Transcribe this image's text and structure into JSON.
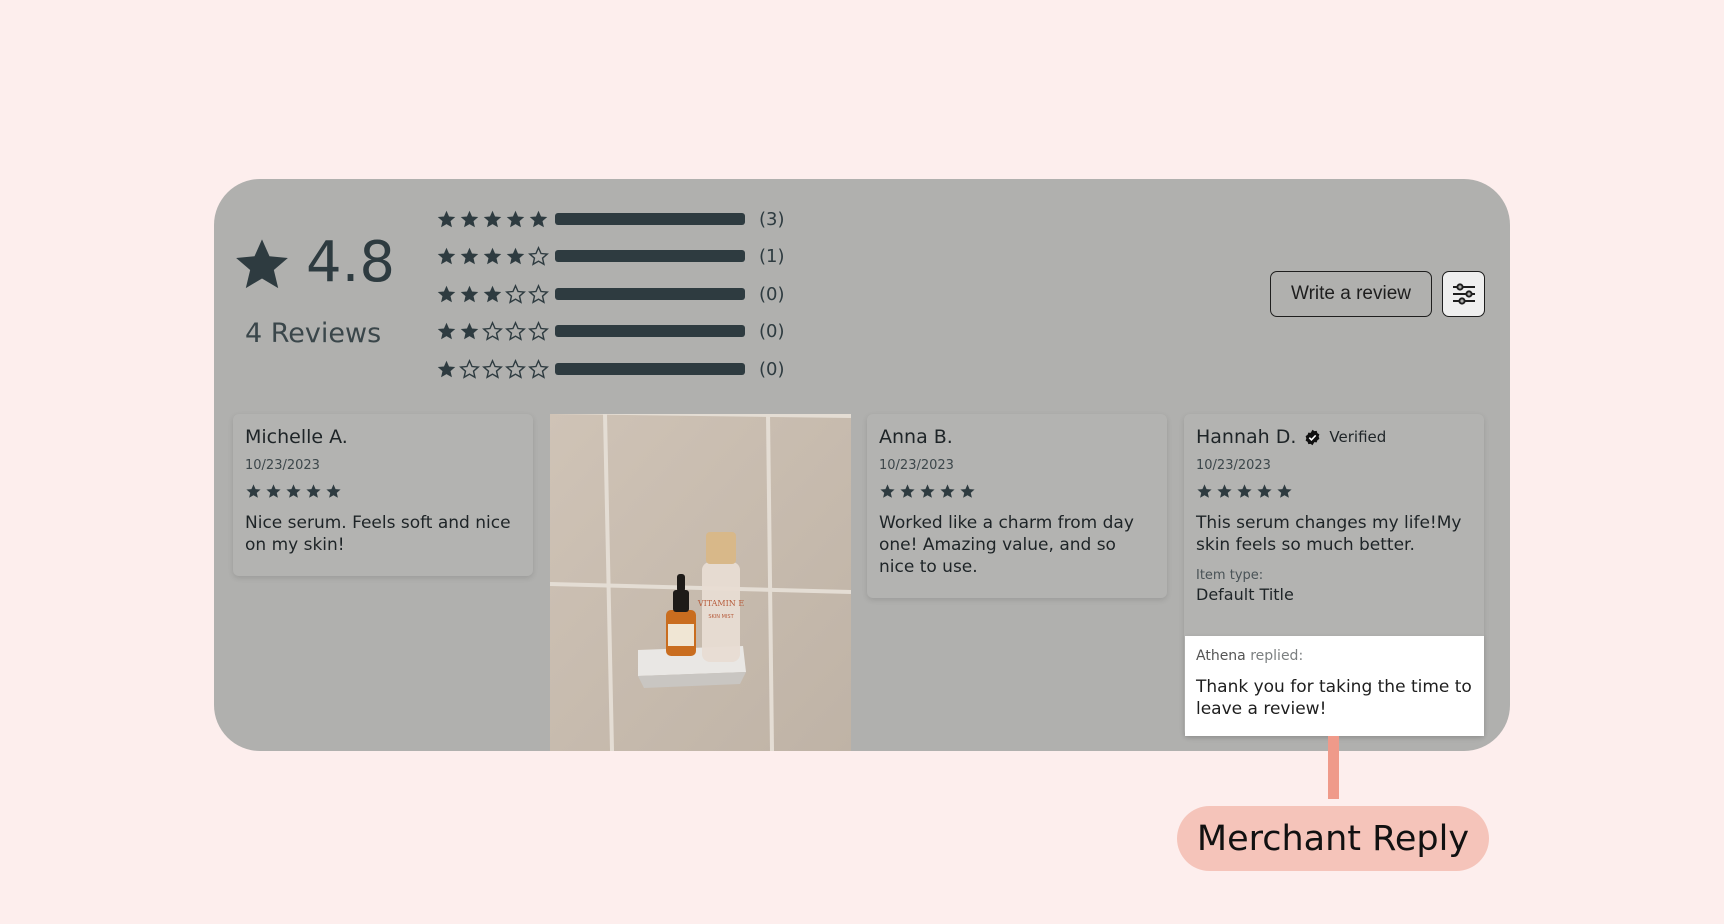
{
  "summary": {
    "average": "4.8",
    "reviews_label": "4 Reviews",
    "distribution": [
      {
        "stars": 5,
        "count_label": "(3)",
        "fraction": 1.0
      },
      {
        "stars": 4,
        "count_label": "(1)",
        "fraction": 1.0
      },
      {
        "stars": 3,
        "count_label": "(0)",
        "fraction": 1.0
      },
      {
        "stars": 2,
        "count_label": "(0)",
        "fraction": 1.0
      },
      {
        "stars": 1,
        "count_label": "(0)",
        "fraction": 1.0
      }
    ]
  },
  "actions": {
    "write_review_label": "Write a review",
    "filter_icon": "sliders-icon"
  },
  "reviews": [
    {
      "name": "Michelle A.",
      "date": "10/23/2023",
      "rating": 5,
      "body": "Nice serum. Feels soft and nice on my skin!"
    },
    {
      "name": "Anna B.",
      "date": "10/23/2023",
      "rating": 5,
      "body": "Worked like a charm from day one! Amazing value, and so nice to use."
    },
    {
      "name": "Hannah D.",
      "verified_label": "Verified",
      "date": "10/23/2023",
      "rating": 5,
      "body": "This serum changes my life!My skin feels so much better.",
      "item_type_label": "Item type:",
      "item_type_value": "Default Title",
      "reply": {
        "author": "Athena",
        "replied_label": " replied:",
        "text": "Thank you for taking the time to leave a review!"
      }
    }
  ],
  "photo": {
    "bottle_label": "VITAMIN E",
    "bottle_sub": "SKIN MIST"
  },
  "callout": {
    "label": "Merchant Reply"
  },
  "colors": {
    "star": "#2e3b40",
    "background": "#fdeeed",
    "widget": "#b0b0ae",
    "callout": "#f5c4ba",
    "connector": "#ef9a8a"
  }
}
